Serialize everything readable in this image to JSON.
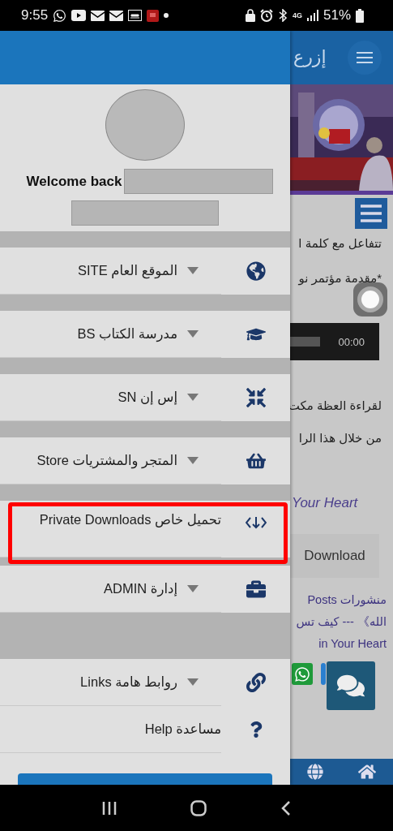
{
  "status_bar": {
    "time": "9:55",
    "network": "4G",
    "battery": "51%"
  },
  "drawer": {
    "welcome": "Welcome back",
    "sections": [
      {
        "items": [
          {
            "kind": "menu",
            "label": "الموقع العام SITE",
            "highlighted": false
          }
        ]
      },
      {
        "items": [
          {
            "kind": "menu",
            "label": "مدرسة الكتاب BS",
            "highlighted": false
          }
        ]
      },
      {
        "items": [
          {
            "kind": "menu",
            "label": "إس إن SN",
            "highlighted": false
          }
        ]
      },
      {
        "items": [
          {
            "kind": "menu",
            "label": "المتجر والمشتريات Store",
            "highlighted": false
          }
        ]
      },
      {
        "items": [
          {
            "kind": "link",
            "label": "تحميل خاص Private Downloads",
            "highlighted": true
          }
        ]
      },
      {
        "items": [
          {
            "kind": "menu",
            "label": "إدارة ADMIN",
            "highlighted": false
          }
        ]
      },
      {
        "items": [
          {
            "kind": "menu",
            "label": "روابط هامة Links",
            "highlighted": false
          },
          {
            "kind": "link",
            "label": "مساعدة Help",
            "highlighted": false
          }
        ]
      }
    ]
  },
  "page": {
    "title": "إزرع",
    "intro_lines": [
      "تتفاعل مع كلمة ا",
      "*مقدمة مؤتمر نو"
    ],
    "player_time": "00:00",
    "body_lines": [
      "لقراءة العظة مكت",
      "من خلال هذا الرا"
    ],
    "link_text": "Your Heart",
    "download": "Download",
    "post_lines": [
      "منشورات Posts",
      "الله》 --- كيف تس",
      "in Your Heart"
    ]
  }
}
